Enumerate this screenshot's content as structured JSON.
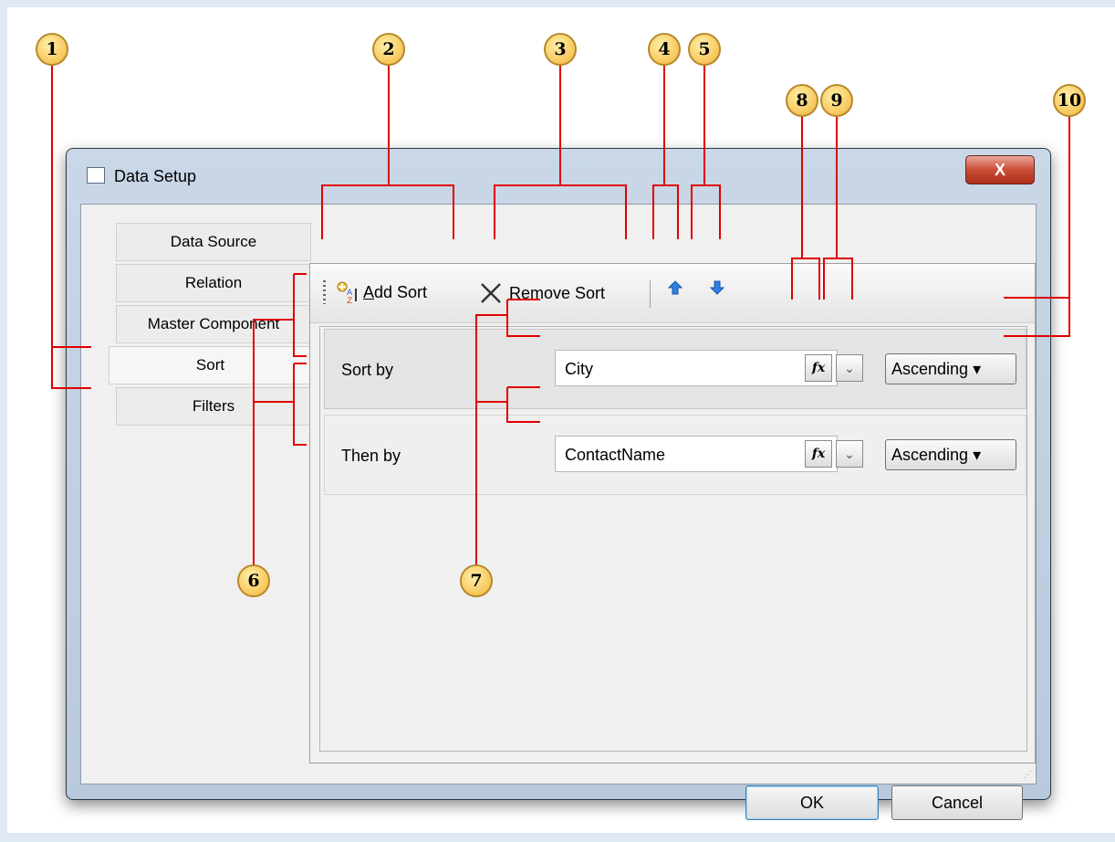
{
  "window": {
    "title": "Data Setup",
    "close_glyph": "X"
  },
  "tabs": [
    {
      "label": "Data Source"
    },
    {
      "label": "Relation"
    },
    {
      "label": "Master Component"
    },
    {
      "label": "Sort"
    },
    {
      "label": "Filters"
    }
  ],
  "active_tab": "Sort",
  "toolbar": {
    "add_sort_label": "Add Sort",
    "add_sort_mnemonic": "A",
    "remove_sort_label": "Remove Sort",
    "remove_sort_mnemonic": "R",
    "move_up_icon": "arrow-up-icon",
    "move_down_icon": "arrow-down-icon"
  },
  "sort_rows": [
    {
      "label": "Sort by",
      "field": "City",
      "order": "Ascending",
      "selected": true
    },
    {
      "label": "Then by",
      "field": "ContactName",
      "order": "Ascending",
      "selected": false
    }
  ],
  "buttons": {
    "ok": "OK",
    "cancel": "Cancel"
  },
  "callouts": [
    "1",
    "2",
    "3",
    "4",
    "5",
    "6",
    "7",
    "8",
    "9",
    "10"
  ],
  "fx_glyph": "fx",
  "dropdown_glyph": "⌄",
  "colors": {
    "callout_line": "#e00000",
    "callout_fill": "#f7c65a"
  }
}
